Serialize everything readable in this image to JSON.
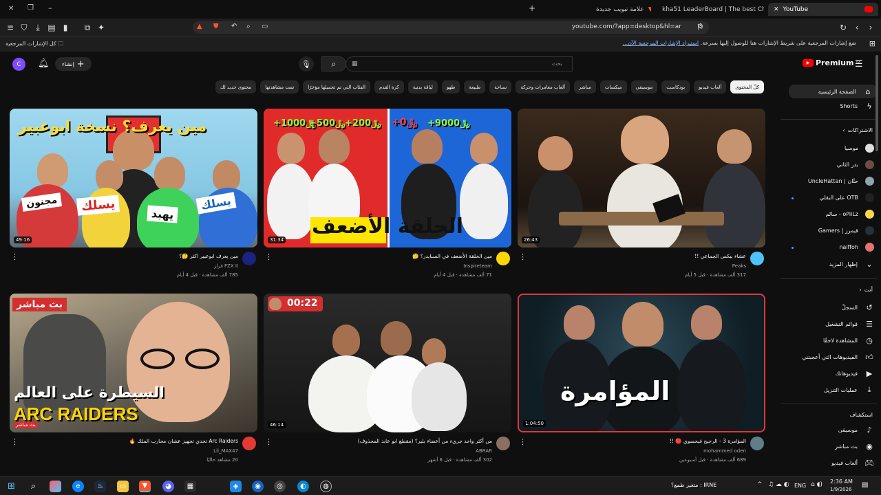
{
  "browser": {
    "tabs": [
      {
        "label": "YouTube"
      },
      {
        "label": "kha51 LeaderBoard | The best ChatBo"
      },
      {
        "label": "علامة تبويب جديدة"
      }
    ],
    "url": "youtube.com/?app=desktop&hl=ar",
    "bookmarks_hint": "ضع إشارات المرجعية على شريط الإشارات هنا للوصول إليها بسرعة.",
    "bookmarks_import": "استيراد الإشارات المرجعية الآن...",
    "all_bookmarks": "كل الإشارات المرجعية"
  },
  "yt": {
    "logo": "Premium",
    "logo_sup": "SA",
    "search_placeholder": "بحث",
    "create_label": "إنشاء",
    "avatar_letter": "C",
    "chips": [
      "كلّ المحتوى",
      "ألعاب فيديو",
      "بودكاست",
      "موسيقى",
      "ميكسات",
      "مباشر",
      "ألعاب مغامرات وحركة",
      "سباحة",
      "طبيعة",
      "طهو",
      "لياقة بدنية",
      "كرة القدم",
      "الفئات التي تم تحميلها مؤخرًا",
      "تمت مشاهدتها",
      "محتوى جديد لك"
    ]
  },
  "sidebar": {
    "home": "الصفحة الرئيسية",
    "shorts": "Shorts",
    "subs_title": "الاشتراكات",
    "subs": [
      "موسيا",
      "بدر الثاني",
      "UncleHattan | حتّان",
      "على البقلي OTB",
      "سالم - oPiiLz",
      "Gamers | قيمرز",
      "naiffoh"
    ],
    "show_more": "إظهار المزيد",
    "you_title": "أنت",
    "you": [
      "السجلّ",
      "قوائم التشغيل",
      "المشاهدة لاحقًا",
      "الفيديوهات التي أعجبتني",
      "فيديوهاتك",
      "عمليات التنزيل"
    ],
    "explore_title": "استكشاف",
    "explore": [
      "موسيقى",
      "بث مباشر",
      "ألعاب فيديو"
    ]
  },
  "videos": [
    {
      "title": "عشاء بيكس الجماعي !!",
      "channel": "Peaks",
      "stats": "317 ألف مشاهدة · قبل 5 أيام",
      "duration": "26:43",
      "overlay": ""
    },
    {
      "title": "مين الحلقة الأضعف في السبايدر؟ 🤔",
      "channel": "Inspireteam",
      "stats": "71 ألف مشاهدة · قبل 4 أيام",
      "duration": "31:34",
      "overlay": "الحلقة الأضعف"
    },
    {
      "title": "مين يعرف ابوعبير اكثر 🤔؟",
      "channel": "FZX II فراز",
      "stats": "785 ألف مشاهدة · قبل 4 أيام",
      "duration": "49:16",
      "overlay": "مين يعرف؟ نسخة ابوعبير"
    },
    {
      "title": "المؤامرة 3 - الرجيح فيحسوي 🔴 !!",
      "channel": "mohammed oden",
      "stats": "689 ألف مشاهدة · قبل أسبوعين",
      "duration": "1:04:50",
      "overlay": "المؤامرة"
    },
    {
      "title": "من أكثر واحد جريء من أعضاء بلير؟ (مقطع ابو عابد المحذوف)",
      "channel": "ABRAR",
      "stats": "302 ألف مشاهدة · قبل 6 أشهر",
      "duration": "46:14",
      "overlay": "00:22"
    },
    {
      "title": "Arc Raiders تحدي تجهيز عشان محارب الملك 🔥",
      "channel": "Lil_MAX47",
      "stats": "20 مشاهد حاليًا",
      "duration": "بث مباشر",
      "overlay": "بث مباشر"
    }
  ],
  "thumb_text": {
    "v1_money": [
      "+200﷼",
      "+500﷼",
      "+1000﷼",
      "+0﷼",
      "+9000﷼"
    ],
    "v3_tags": [
      "مجنون",
      "يسلك",
      "يهبد",
      "يسلك"
    ],
    "v6_line1": "السيطرة على العالم",
    "v6_line2": "ARC RAIDERS"
  },
  "taskbar": {
    "time": "2:36 AM",
    "date": "1/9/2026",
    "lang": "ENG",
    "notif": "IRNE : متغير طمع؟"
  },
  "colors": {
    "brand_red": "#ff0000",
    "bg": "#0f0f0f",
    "chip": "#272727",
    "link": "#3ea6ff"
  }
}
